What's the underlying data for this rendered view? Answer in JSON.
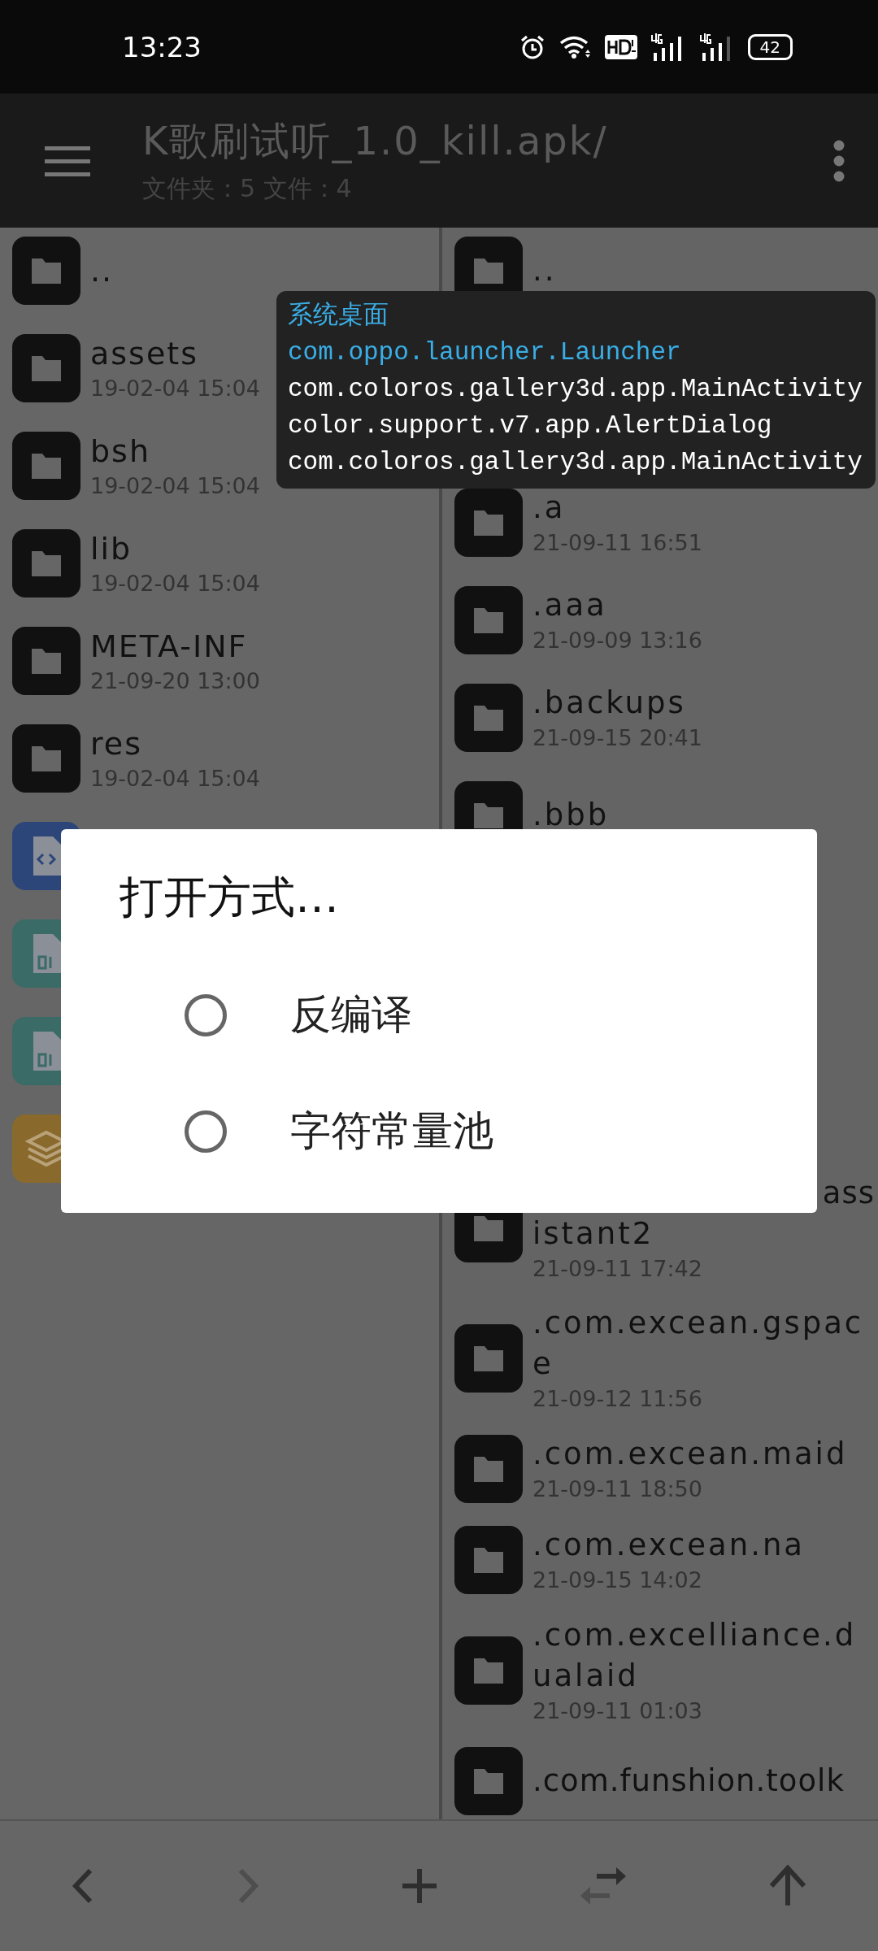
{
  "status_bar": {
    "time": "13:23",
    "battery": "42"
  },
  "toolbar": {
    "title": "K歌刷试听_1.0_kill.apk/",
    "subtitle": "文件夹：5 文件：4"
  },
  "left_pane": {
    "items": [
      {
        "kind": "folder",
        "name": ".."
      },
      {
        "kind": "folder",
        "name": "assets",
        "date": "19-02-04 15:04"
      },
      {
        "kind": "folder",
        "name": "bsh",
        "date": "19-02-04 15:04"
      },
      {
        "kind": "folder",
        "name": "lib",
        "date": "19-02-04 15:04"
      },
      {
        "kind": "folder",
        "name": "META-INF",
        "date": "21-09-20 13:00"
      },
      {
        "kind": "folder",
        "name": "res",
        "date": "19-02-04 15:04"
      },
      {
        "kind": "code"
      },
      {
        "kind": "binary"
      },
      {
        "kind": "binary"
      },
      {
        "kind": "layers"
      }
    ]
  },
  "right_pane": {
    "rows_above_popup": [
      {
        "name": ".."
      }
    ],
    "rows_between": [
      {
        "name": ".a",
        "date": "21-09-11 16:51"
      },
      {
        "name": ".aaa",
        "date": "21-09-09 13:16"
      },
      {
        "name": ".backups",
        "date": "21-09-15 20:41"
      },
      {
        "name": ".bbb"
      }
    ],
    "rows_below_dialog": [
      {
        "name_tail": "ass",
        "name": "istant2",
        "date": "21-09-11 17:42"
      },
      {
        "name": ".com.excean.gspace",
        "date": "21-09-12 11:56"
      },
      {
        "name": ".com.excean.maid",
        "date": "21-09-11 18:50"
      },
      {
        "name": ".com.excean.na",
        "date": "21-09-15 14:02"
      },
      {
        "name": ".com.excelliance.dualaid",
        "date": "21-09-11 01:03"
      },
      {
        "name": ".com.funshion.toolk"
      }
    ]
  },
  "activity_popup": {
    "lines": [
      {
        "text": "系统桌面",
        "current": true
      },
      {
        "text": "com.oppo.launcher.Launcher",
        "current": true
      },
      {
        "text": "com.coloros.gallery3d.app.MainActivity",
        "current": false
      },
      {
        "text": "color.support.v7.app.AlertDialog",
        "current": false
      },
      {
        "text": "com.coloros.gallery3d.app.MainActivity",
        "current": false
      }
    ]
  },
  "dialog": {
    "title": "打开方式…",
    "options": [
      {
        "label": "反编译",
        "selected": false
      },
      {
        "label": "字符常量池",
        "selected": false
      }
    ]
  },
  "bottom_bar": {
    "buttons": [
      {
        "kind": "back",
        "disabled": false
      },
      {
        "kind": "forward",
        "disabled": true
      },
      {
        "kind": "add",
        "disabled": false
      },
      {
        "kind": "swap",
        "disabled": false
      },
      {
        "kind": "up",
        "disabled": false
      }
    ]
  }
}
